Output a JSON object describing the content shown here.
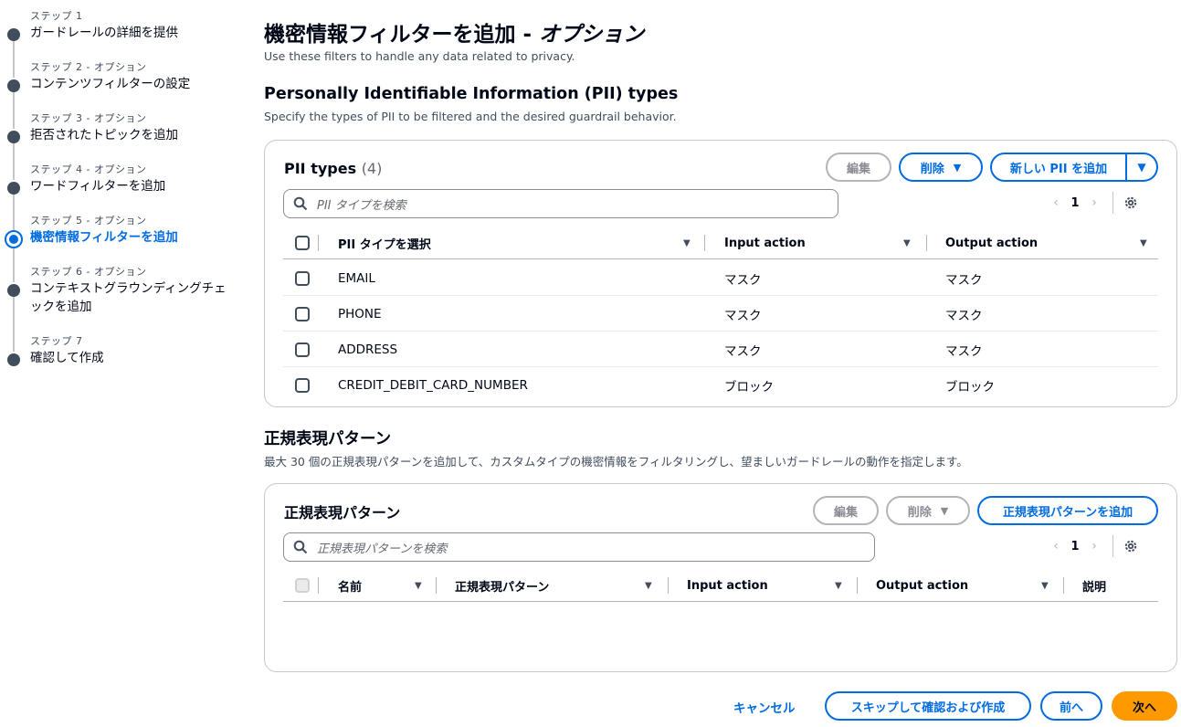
{
  "steps": [
    {
      "label": "ステップ 1",
      "title": "ガードレールの詳細を提供"
    },
    {
      "label": "ステップ 2 - オプション",
      "title": "コンテンツフィルターの設定"
    },
    {
      "label": "ステップ 3 - オプション",
      "title": "拒否されたトピックを追加"
    },
    {
      "label": "ステップ 4 - オプション",
      "title": "ワードフィルターを追加"
    },
    {
      "label": "ステップ 5 - オプション",
      "title": "機密情報フィルターを追加"
    },
    {
      "label": "ステップ 6 - オプション",
      "title": "コンテキストグラウンディングチェックを追加"
    },
    {
      "label": "ステップ 7",
      "title": "確認して作成"
    }
  ],
  "page": {
    "title": "機密情報フィルターを追加 - ",
    "title_optional": "オプション",
    "description": "Use these filters to handle any data related to privacy."
  },
  "pii_section": {
    "heading": "Personally Identifiable Information (PII) types",
    "description": "Specify the types of PII to be filtered and the desired guardrail behavior.",
    "panel_title": "PII types",
    "count": "(4)",
    "edit_label": "編集",
    "delete_label": "削除",
    "add_label": "新しい PII を追加",
    "search_placeholder": "PII タイプを検索",
    "page_number": "1",
    "columns": [
      "PII タイプを選択",
      "Input action",
      "Output action"
    ],
    "rows": [
      {
        "type": "EMAIL",
        "input": "マスク",
        "output": "マスク"
      },
      {
        "type": "PHONE",
        "input": "マスク",
        "output": "マスク"
      },
      {
        "type": "ADDRESS",
        "input": "マスク",
        "output": "マスク"
      },
      {
        "type": "CREDIT_DEBIT_CARD_NUMBER",
        "input": "ブロック",
        "output": "ブロック"
      }
    ]
  },
  "regex_section": {
    "heading": "正規表現パターン",
    "description": "最大 30 個の正規表現パターンを追加して、カスタムタイプの機密情報をフィルタリングし、望ましいガードレールの動作を指定します。",
    "panel_title": "正規表現パターン",
    "edit_label": "編集",
    "delete_label": "削除",
    "add_label": "正規表現パターンを追加",
    "search_placeholder": "正規表現パターンを検索",
    "page_number": "1",
    "columns": [
      "名前",
      "正規表現パターン",
      "Input action",
      "Output action",
      "説明"
    ]
  },
  "footer": {
    "cancel": "キャンセル",
    "skip": "スキップして確認および作成",
    "previous": "前へ",
    "next": "次へ"
  },
  "colors": {
    "accent": "#006ce0",
    "primary_button": "#ff9900",
    "text": "#000716"
  }
}
